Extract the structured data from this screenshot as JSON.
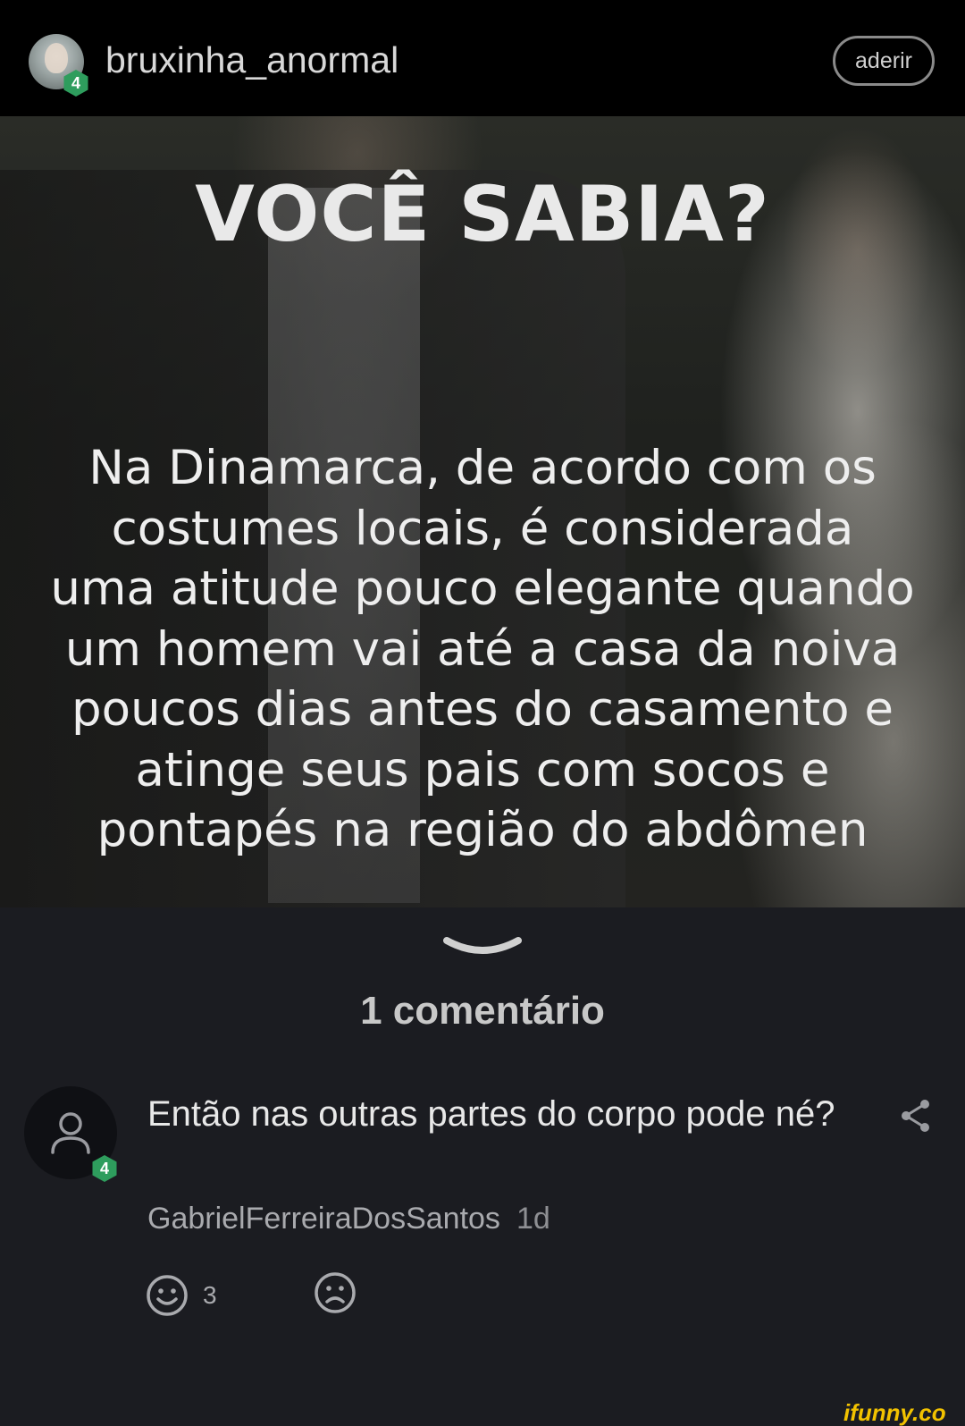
{
  "header": {
    "username": "bruxinha_anormal",
    "user_level": "4",
    "join_label": "aderir"
  },
  "meme": {
    "title": "VOCÊ SABIA?",
    "body": "Na Dinamarca, de acordo com os\ncostumes locais, é considerada\numa atitude pouco elegante quando\num homem vai até a casa da noiva\npoucos dias antes do casamento e\natinge seus pais com socos e\npontapés na região do abdômen"
  },
  "comments": {
    "count_label": "1 comentário",
    "items": [
      {
        "text": "Então nas outras partes do corpo pode né?",
        "author": "GabrielFerreiraDosSantos",
        "time": "1d",
        "author_level": "4",
        "likes": "3"
      }
    ]
  },
  "watermark": "ifunny.co",
  "colors": {
    "header_bg": "#000000",
    "page_bg": "#1b1c21",
    "level_badge": "#2e9d5d",
    "watermark": "#f2c200"
  },
  "icons": [
    "chevron-down-icon",
    "user-icon",
    "share-icon",
    "smile-icon",
    "frown-icon"
  ]
}
